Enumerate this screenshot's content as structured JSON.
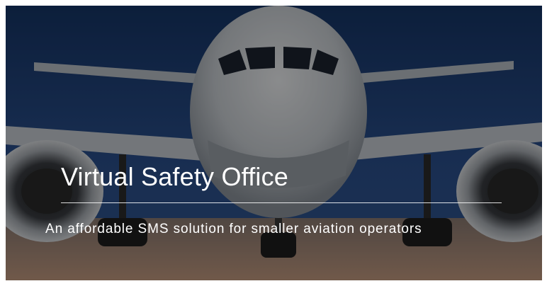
{
  "hero": {
    "title": "Virtual Safety Office",
    "subtitle": "An affordable SMS solution for smaller aviation operators",
    "background_icon": "airplane-front-view-image",
    "colors": {
      "sky": "#1f3f78",
      "fuselage": "#d4d8dc",
      "overlay": "#000000",
      "text": "#ffffff"
    }
  }
}
